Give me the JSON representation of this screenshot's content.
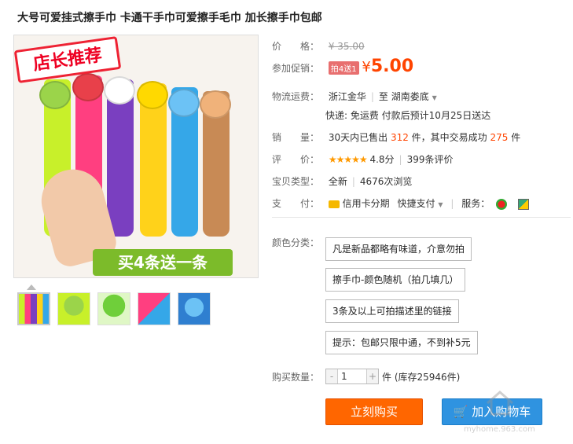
{
  "product": {
    "title": "大号可爱挂式擦手巾 卡通干手巾可爱擦手毛巾 加长擦手巾包邮",
    "main_image": {
      "badge_text": "店长推荐",
      "promo_text": "买4条送一条"
    },
    "thumbnail_count": 5
  },
  "info": {
    "price_label": "价　　格：",
    "price_old": "¥ 35.00",
    "promo_label": "参加促销：",
    "promo_tag": "拍4送1",
    "yen_symbol": "¥",
    "price_new": "5.00",
    "shipping_label": "物流运费：",
    "shipping_from": "浙江金华",
    "shipping_to_prefix": "至",
    "shipping_to": "湖南娄底",
    "shipping_detail": "快递: 免运费  付款后预计10月25日送达",
    "sales_label": "销　　量：",
    "sales_prefix": "30天内已售出",
    "sales_count": "312",
    "sales_mid": "件，其中交易成功",
    "sales_success": "275",
    "sales_suffix": "件",
    "rating_label": "评　　价：",
    "rating_stars": "★★★★★",
    "rating_score": "4.8分",
    "rating_reviews": "399条评价",
    "type_label": "宝贝类型：",
    "type_value": "全新",
    "type_views": "4676次浏览",
    "pay_label": "支　　付：",
    "pay_credit": "信用卡分期",
    "pay_fast": "快捷支付",
    "service_label": "服务："
  },
  "options": {
    "color_label": "颜色分类：",
    "items": [
      "凡是新品都略有味道，介意勿拍",
      "擦手巾-颜色随机（拍几填几）",
      "3条及以上可拍描述里的链接",
      "提示：包邮只限中通，不到补5元"
    ]
  },
  "quantity": {
    "label": "购买数量：",
    "minus": "-",
    "value": "1",
    "plus": "+",
    "stock": "件 (库存25946件)"
  },
  "actions": {
    "buy_now": "立刻购买",
    "add_cart": "加入购物车"
  },
  "watermark": "myhome.963.com",
  "colors": {
    "accent": "#ff4400",
    "buy": "#ff6600",
    "cart": "#2f93e0"
  }
}
